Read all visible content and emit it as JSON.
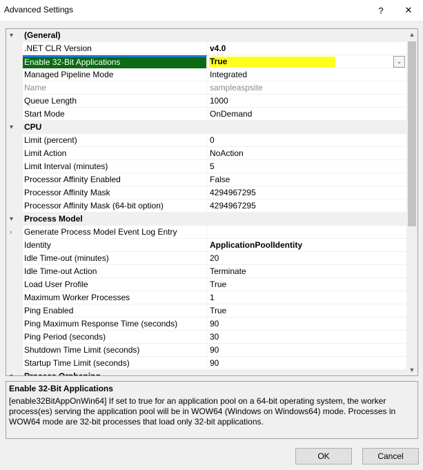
{
  "window": {
    "title": "Advanced Settings",
    "help_glyph": "?",
    "close_glyph": "✕"
  },
  "grid": {
    "categories": [
      {
        "label": "(General)",
        "rows": [
          {
            "name": ".NET CLR Version",
            "value": "v4.0",
            "bold": true
          },
          {
            "name": "Enable 32-Bit Applications",
            "value": "True",
            "bold": true,
            "selected": true,
            "highlight": "#ffff1e"
          },
          {
            "name": "Managed Pipeline Mode",
            "value": "Integrated"
          },
          {
            "name": "Name",
            "value": "sampleaspsite",
            "disabled": true
          },
          {
            "name": "Queue Length",
            "value": "1000"
          },
          {
            "name": "Start Mode",
            "value": "OnDemand"
          }
        ]
      },
      {
        "label": "CPU",
        "rows": [
          {
            "name": "Limit (percent)",
            "value": "0"
          },
          {
            "name": "Limit Action",
            "value": "NoAction"
          },
          {
            "name": "Limit Interval (minutes)",
            "value": "5"
          },
          {
            "name": "Processor Affinity Enabled",
            "value": "False"
          },
          {
            "name": "Processor Affinity Mask",
            "value": "4294967295"
          },
          {
            "name": "Processor Affinity Mask (64-bit option)",
            "value": "4294967295"
          }
        ]
      },
      {
        "label": "Process Model",
        "rows": [
          {
            "name": "Generate Process Model Event Log Entry",
            "value": "",
            "expandable": true
          },
          {
            "name": "Identity",
            "value": "ApplicationPoolIdentity",
            "bold": true
          },
          {
            "name": "Idle Time-out (minutes)",
            "value": "20"
          },
          {
            "name": "Idle Time-out Action",
            "value": "Terminate"
          },
          {
            "name": "Load User Profile",
            "value": "True"
          },
          {
            "name": "Maximum Worker Processes",
            "value": "1"
          },
          {
            "name": "Ping Enabled",
            "value": "True"
          },
          {
            "name": "Ping Maximum Response Time (seconds)",
            "value": "90"
          },
          {
            "name": "Ping Period (seconds)",
            "value": "30"
          },
          {
            "name": "Shutdown Time Limit (seconds)",
            "value": "90"
          },
          {
            "name": "Startup Time Limit (seconds)",
            "value": "90"
          }
        ]
      },
      {
        "label": "Process Orphaning",
        "rows": []
      }
    ]
  },
  "description": {
    "title": "Enable 32-Bit Applications",
    "text": "[enable32BitAppOnWin64] If set to true for an application pool on a 64-bit operating system, the worker process(es) serving the application pool will be in WOW64 (Windows on Windows64) mode. Processes in WOW64 mode are 32-bit processes that load only 32-bit applications."
  },
  "buttons": {
    "ok": "OK",
    "cancel": "Cancel"
  },
  "colors": {
    "selection_name_bg": "#0a6b12",
    "selection_top_bar": "#1e78d4",
    "highlight": "#ffff1e"
  }
}
